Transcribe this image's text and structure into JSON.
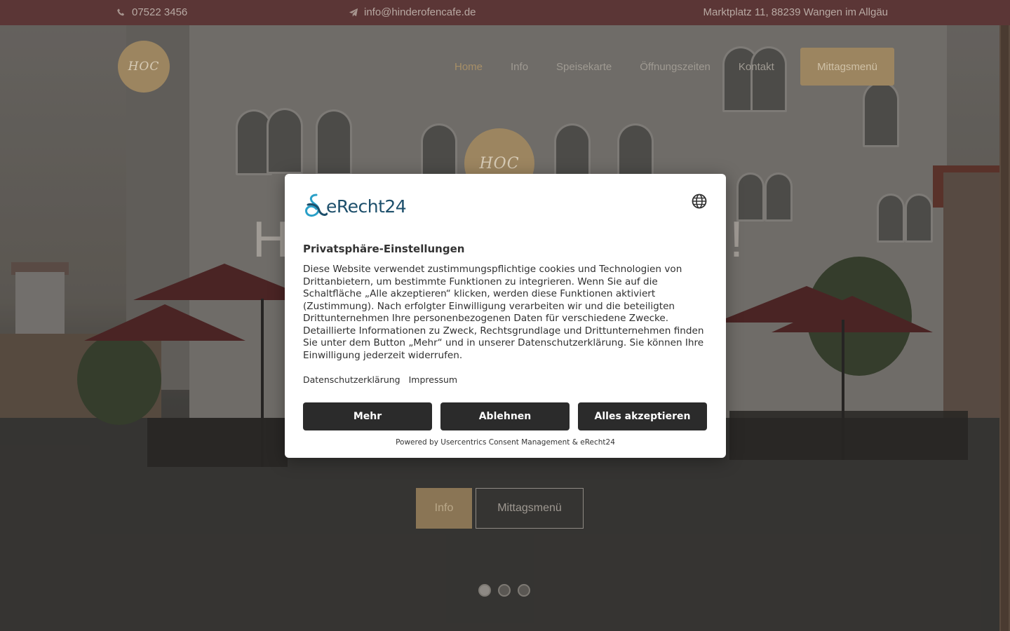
{
  "topbar": {
    "phone": "07522 3456",
    "email": "info@hinderofencafe.de",
    "address": "Marktplatz 11, 88239 Wangen im Allgäu",
    "phone_icon": "phone-icon",
    "email_icon": "paper-plane-icon"
  },
  "header": {
    "logo_text": "HOC",
    "nav": [
      "Home",
      "Info",
      "Speisekarte",
      "Öffnungszeiten",
      "Kontakt"
    ],
    "active_nav": "Home",
    "cta_label": "Mittagsmenü"
  },
  "hero": {
    "logo_text": "HOC",
    "title_left": "H",
    "title_right": "!",
    "buttons": {
      "info_label": "Info",
      "mittag_label": "Mittagsmenü"
    },
    "slides": 3,
    "active_slide": 1
  },
  "cookie_modal": {
    "brand": "eRecht24",
    "globe_icon": "globe-icon",
    "title": "Privatsphäre-Einstellungen",
    "body": "Diese Website verwendet zustimmungspflichtige cookies und Technologien von Drittanbietern, um bestimmte Funktionen zu integrieren. Wenn Sie auf die Schaltfläche „Alle akzeptieren“ klicken, werden diese Funktionen aktiviert (Zustimmung). Nach erfolgter Einwilligung verarbeiten wir und die beteiligten Drittunternehmen Ihre personenbezogenen Daten für verschiedene Zwecke. Detaillierte Informationen zu Zweck, Rechtsgrundlage und Drittunternehmen finden Sie unter dem Button „Mehr“ und in unserer Datenschutzerklärung. Sie können Ihre Einwilligung jederzeit widerrufen.",
    "links": {
      "privacy": "Datenschutzerklärung",
      "imprint": "Impressum"
    },
    "buttons": {
      "more": "Mehr",
      "deny": "Ablehnen",
      "accept": "Alles akzeptieren"
    },
    "powered_by": "Powered by Usercentrics Consent Management & eRecht24"
  },
  "colors": {
    "topbar_bg": "#5b3636",
    "accent_gold": "#9c8560",
    "modal_button": "#2b2b2b",
    "brand_blue": "#1d4f6b"
  }
}
